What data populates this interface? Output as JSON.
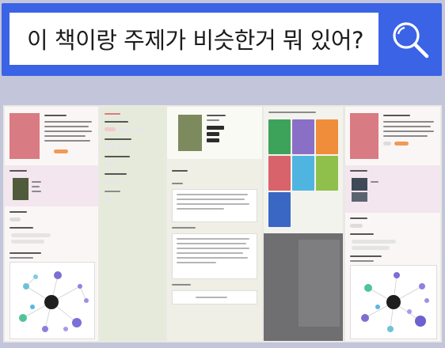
{
  "search": {
    "query": "이 책이랑 주제가 비슷한거 뭐 있어?",
    "icon": "search-icon"
  },
  "colors": {
    "background": "#c3c6da",
    "search_bar": "#3b63e6",
    "search_field": "#ffffff",
    "accent_pink": "#d97b83",
    "accent_orange": "#f09a55"
  },
  "screenshots": [
    {
      "id": "book-detail-mindmap-left"
    },
    {
      "id": "filter-menu"
    },
    {
      "id": "book-review-detail"
    },
    {
      "id": "category-tiles"
    },
    {
      "id": "book-detail-mindmap-right"
    }
  ]
}
